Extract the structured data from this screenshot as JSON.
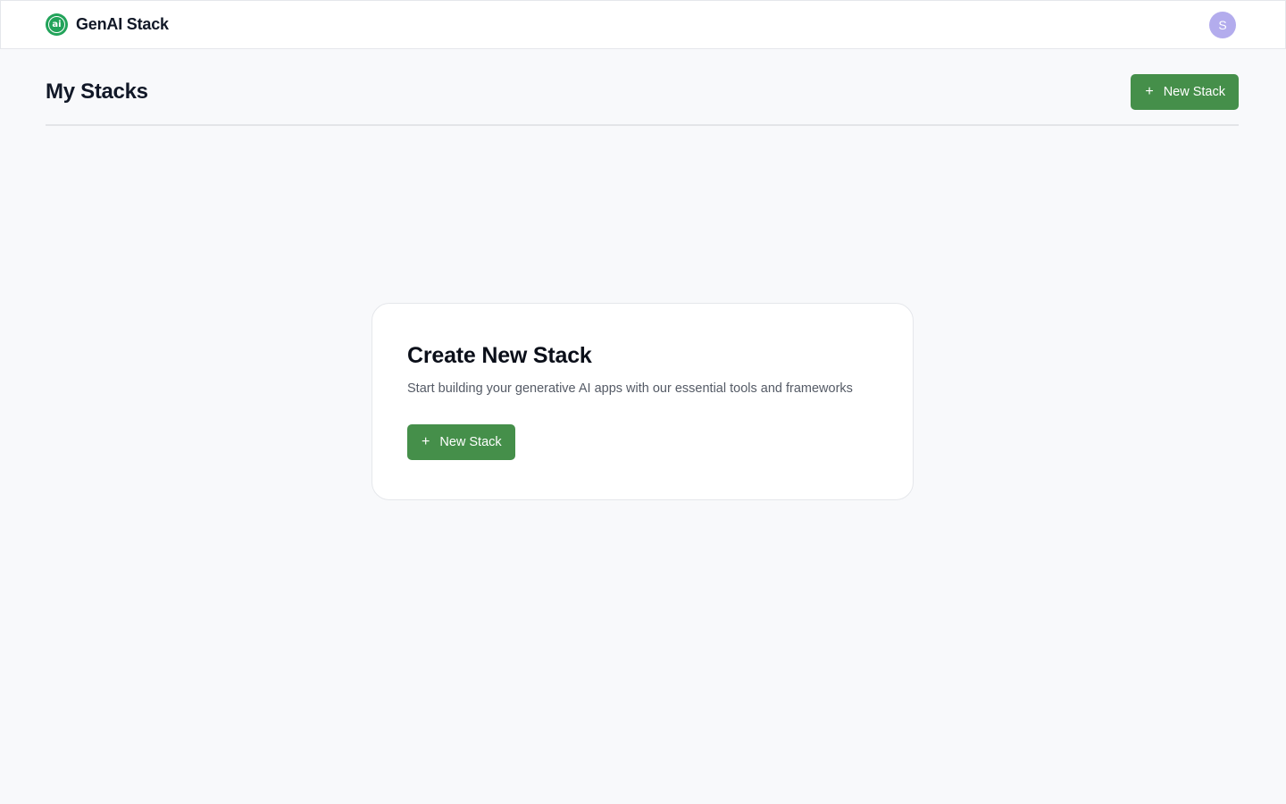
{
  "app": {
    "brand_name": "GenAI Stack",
    "logo_text": "ai",
    "user_initial": "S"
  },
  "page": {
    "title": "My Stacks",
    "new_stack_label": "New Stack"
  },
  "empty_state": {
    "title": "Create New Stack",
    "description": "Start building your generative AI apps with our essential tools and frameworks",
    "button_label": "New Stack"
  },
  "icons": {
    "plus": "+"
  },
  "colors": {
    "accent": "#458f4a",
    "logo": "#22a35a",
    "avatar": "#b3aced"
  }
}
